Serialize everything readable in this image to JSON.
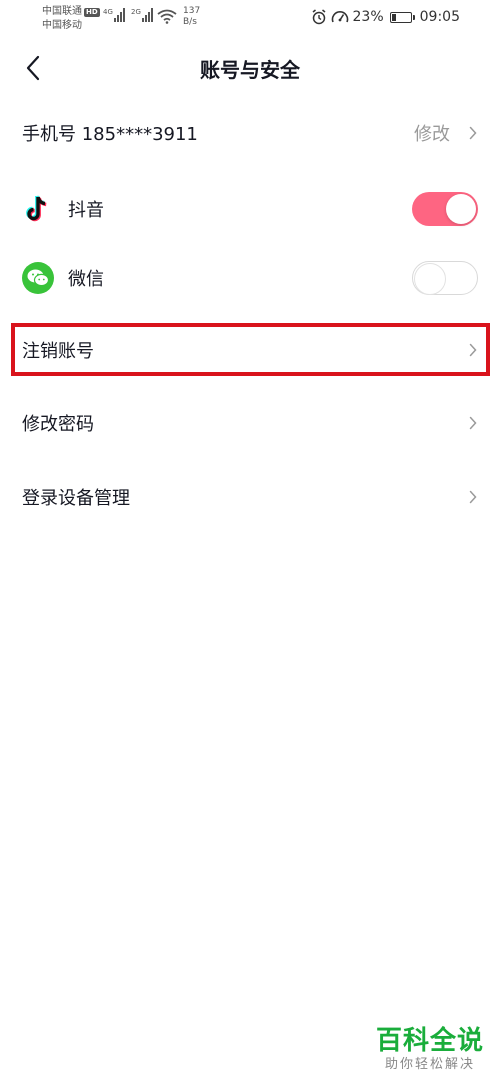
{
  "status_bar": {
    "carrier_1": "中国联通",
    "carrier_1_badge": "HD",
    "carrier_2": "中国移动",
    "net_1": "4G",
    "net_2": "2G",
    "speed_value": "137",
    "speed_unit": "B/s",
    "battery_percent": "23%",
    "battery_level": 0.23,
    "time": "09:05"
  },
  "nav": {
    "title": "账号与安全"
  },
  "phone_row": {
    "label": "手机号 185****3911",
    "action": "修改"
  },
  "bindings": [
    {
      "label": "抖音",
      "icon": "douyin-icon",
      "enabled": true
    },
    {
      "label": "微信",
      "icon": "wechat-icon",
      "enabled": false
    }
  ],
  "menu": {
    "cancel_account": "注销账号",
    "change_password": "修改密码",
    "device_management": "登录设备管理"
  },
  "colors": {
    "toggle_on": "#fe6582",
    "highlight_border": "#d9131c",
    "wechat_green": "#39c33a",
    "watermark_green": "#1aad3b"
  },
  "watermark": {
    "title": "百科全说",
    "subtitle": "助你轻松解决"
  }
}
